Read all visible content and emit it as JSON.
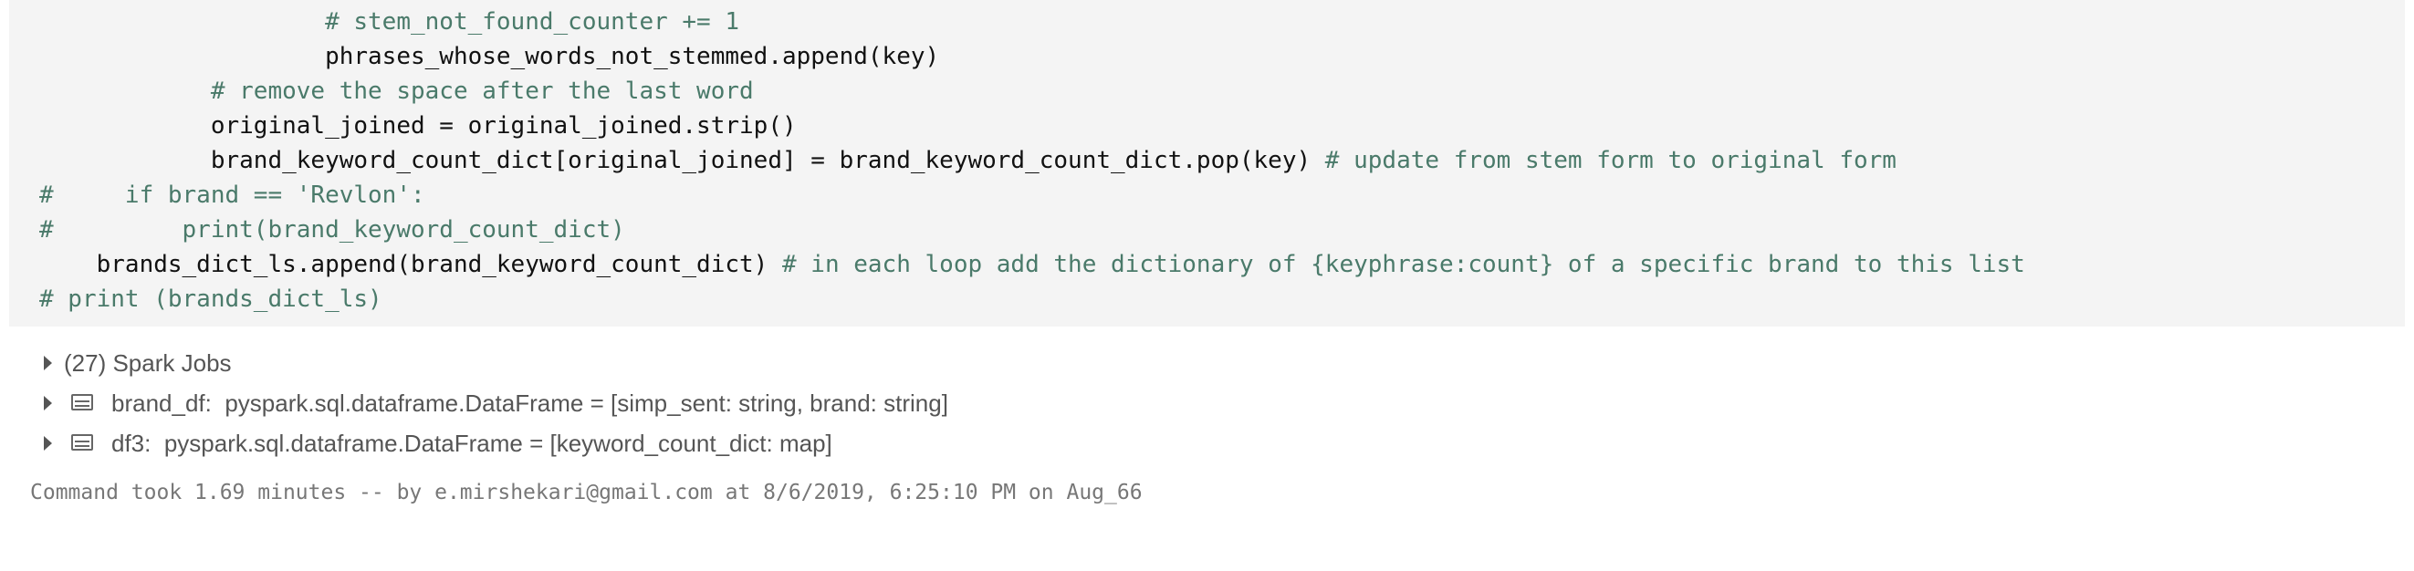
{
  "code_lines": [
    {
      "text": "                    # stem_not_found_counter += 1",
      "comment": true
    },
    {
      "text": "                    phrases_whose_words_not_stemmed.append(key)",
      "comment": false
    },
    {
      "text": "            # remove the space after the last word",
      "comment": true
    },
    {
      "text": "            original_joined = original_joined.strip()",
      "comment": false
    },
    {
      "text": "            brand_keyword_count_dict[original_joined] = brand_keyword_count_dict.pop(key)",
      "comment": false,
      "trailing_comment": " # update from stem form to original form"
    },
    {
      "text": "#     if brand == 'Revlon':",
      "comment": true
    },
    {
      "text": "#         print(brand_keyword_count_dict)",
      "comment": true
    },
    {
      "text": "    brands_dict_ls.append(brand_keyword_count_dict)",
      "comment": false,
      "trailing_comment": " # in each loop add the dictionary of {keyphrase:count} of a specific brand to this list"
    },
    {
      "text": "# print (brands_dict_ls)",
      "comment": true
    }
  ],
  "outputs": [
    {
      "label": "(27) Spark Jobs",
      "icon": "none"
    },
    {
      "label": "brand_df:  pyspark.sql.dataframe.DataFrame = [simp_sent: string, brand: string]",
      "icon": "table-icon"
    },
    {
      "label": "df3:  pyspark.sql.dataframe.DataFrame = [keyword_count_dict: map]",
      "icon": "table-icon"
    }
  ],
  "footer": "Command took 1.69 minutes -- by e.mirshekari@gmail.com at 8/6/2019, 6:25:10 PM on Aug_66",
  "colors": {
    "comment": "#4a7a6a",
    "code": "#111111",
    "cell_bg": "#f4f4f4"
  }
}
